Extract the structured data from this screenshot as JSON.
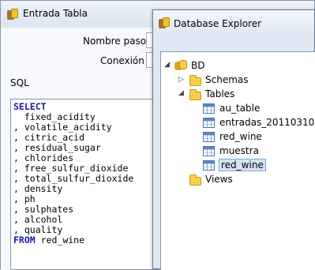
{
  "entrada": {
    "title": "Entrada Tabla",
    "nombre_paso_label": "Nombre paso",
    "conexion_label": "Conexión",
    "sql_label": "SQL",
    "sql_lines": [
      "SELECT",
      "  fixed_acidity",
      ", volatile_acidity",
      ", citric_acid",
      ", residual_sugar",
      ", chlorides",
      ", free_sulfur_dioxide",
      ", total_sulfur_dioxide",
      ", density",
      ", ph",
      ", sulphates",
      ", alcohol",
      ", quality",
      "FROM red_wine"
    ]
  },
  "explorer": {
    "title": "Database Explorer",
    "tree": {
      "root": "BD",
      "schemas": "Schemas",
      "tables": "Tables",
      "table_items": [
        "au_table",
        "entradas_20110310",
        "red_wine",
        "muestra",
        "red_wine"
      ],
      "views": "Views"
    }
  }
}
